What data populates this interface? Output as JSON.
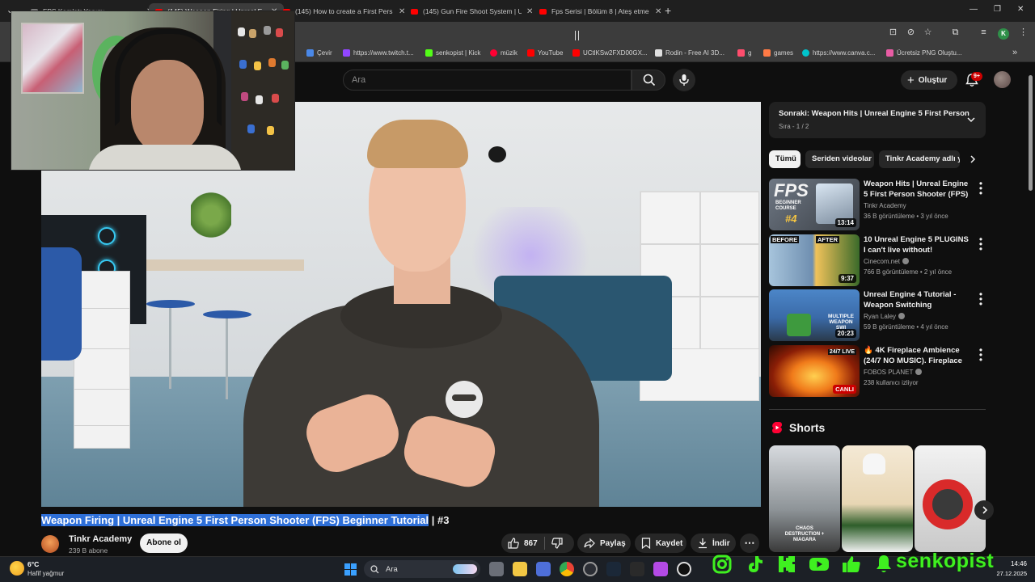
{
  "browser": {
    "tabs": [
      {
        "title": "FPS Kamlatr Yapımı"
      },
      {
        "title": "(145) Weapon Firing | Unreal E"
      },
      {
        "title": "(145) How to create a First Pers"
      },
      {
        "title": "(145) Gun Fire Shoot System | U"
      },
      {
        "title": "Fps Serisi | Bölüm 8 | Ateş etme"
      }
    ],
    "profile_initial": "K",
    "bookmarks": [
      {
        "label": "Çevir",
        "color": "#4a88e8"
      },
      {
        "label": "https://www.twitch.t...",
        "color": "#9146ff"
      },
      {
        "label": "senkopist | Kick",
        "color": "#53fc18"
      },
      {
        "label": "müzik",
        "color": "#ff0033"
      },
      {
        "label": "YouTube",
        "color": "#ff0000"
      },
      {
        "label": "UCtlKSw2FXD00GX...",
        "color": "#ff0000"
      },
      {
        "label": "Rodin - Free AI 3D...",
        "color": "#e0e0e0"
      },
      {
        "label": "g",
        "color": "#ff4d6d"
      },
      {
        "label": "games",
        "color": "#ff7a45"
      },
      {
        "label": "https://www.canva.c...",
        "color": "#00c4cc"
      },
      {
        "label": "Ücretsiz PNG Oluştu...",
        "color": "#e85ca4"
      }
    ]
  },
  "youtube": {
    "search_placeholder": "Ara",
    "create_label": "Oluştur",
    "notif_count": "9+",
    "video": {
      "title_highlighted": "Weapon Firing | Unreal Engine 5 First Person Shooter (FPS) Beginner Tutorial",
      "title_rest": " | #3",
      "channel": "Tinkr Academy",
      "subscribers": "239 B abone",
      "subscribe_label": "Abone ol",
      "likes": "867",
      "share_label": "Paylaş",
      "save_label": "Kaydet",
      "download_label": "İndir"
    },
    "playlist": {
      "next_title": "Sonraki: Weapon Hits | Unreal Engine 5 First Person...",
      "position": "Sıra - 1 / 2"
    },
    "chips": [
      "Tümü",
      "Seriden videolar",
      "Tinkr Academy adlı y"
    ],
    "recommendations": [
      {
        "title": "Weapon Hits | Unreal Engine 5 First Person Shooter (FPS) ...",
        "channel": "Tinkr Academy",
        "verified": false,
        "meta": "36 B görüntüleme • 3 yıl önce",
        "duration": "13:14",
        "thumb_text": "FPS",
        "thumb_sub": "BEGINNER COURSE",
        "thumb_num": "#4"
      },
      {
        "title": "10 Unreal Engine 5 PLUGINS I can't live without!",
        "channel": "Cinecom.net",
        "verified": true,
        "meta": "766 B görüntüleme • 2 yıl önce",
        "duration": "9:37",
        "thumb_before": "BEFORE",
        "thumb_after": "AFTER"
      },
      {
        "title": "Unreal Engine 4 Tutorial - Weapon Switching",
        "channel": "Ryan Laley",
        "verified": true,
        "meta": "59 B görüntüleme • 4 yıl önce",
        "duration": "20:23",
        "thumb_text": "MULTIPLE WEAPON SWI"
      },
      {
        "title": "🔥 4K Fireplace Ambience (24/7 NO MUSIC). Fireplace ...",
        "channel": "FOBOS PLANET",
        "verified": true,
        "meta": "238 kullanıcı izliyor",
        "live_top": "24/7 LIVE",
        "live_label": "CANLI"
      }
    ],
    "shorts_label": "Shorts",
    "shorts": [
      {
        "caption": "CHAOS DESTRUCTION + NIAGARA"
      },
      {
        "caption": ""
      },
      {
        "caption": ""
      }
    ]
  },
  "taskbar": {
    "temperature": "6°C",
    "weather": "Hafif yağmur",
    "search_label": "Ara",
    "time": "14:46",
    "date": "27.12.2025"
  },
  "overlay": {
    "streamer_name": "senkopist"
  }
}
